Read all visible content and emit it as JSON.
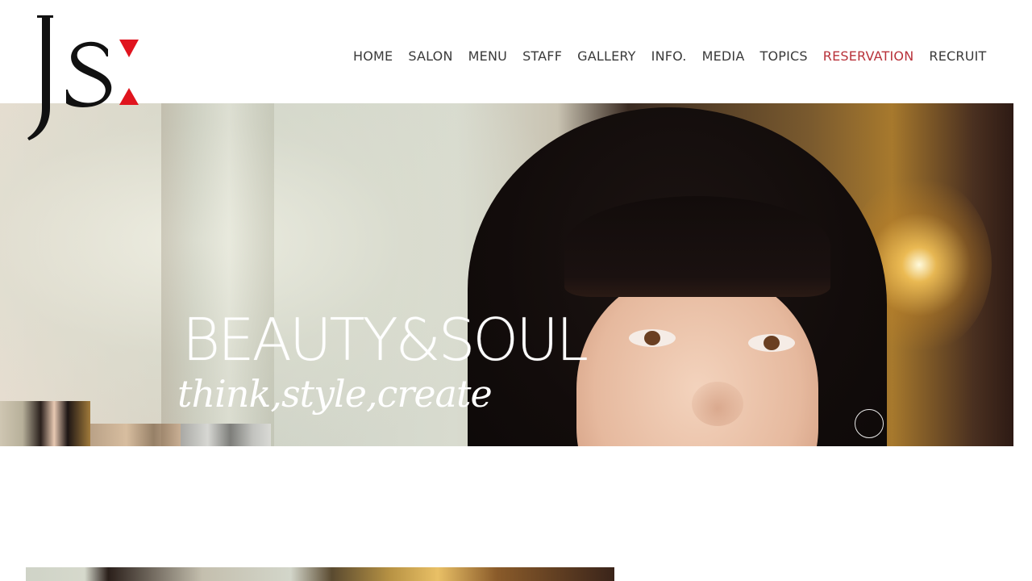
{
  "brand": {
    "logo_text": "JS",
    "logo_accent_color": "#e0141e",
    "logo_color": "#111111"
  },
  "nav": {
    "items": [
      {
        "label": "HOME"
      },
      {
        "label": "SALON"
      },
      {
        "label": "MENU"
      },
      {
        "label": "STAFF"
      },
      {
        "label": "GALLERY"
      },
      {
        "label": "INFO."
      },
      {
        "label": "MEDIA"
      },
      {
        "label": "TOPICS"
      },
      {
        "label": "RESERVATION"
      },
      {
        "label": "RECRUIT"
      }
    ],
    "active_color": "#b8323a",
    "text_color": "#3a3a3a"
  },
  "hero": {
    "title": "BEAUTY&SOUL",
    "subtitle": "think,style,create",
    "slide_count": 3,
    "active_slide": 1
  }
}
